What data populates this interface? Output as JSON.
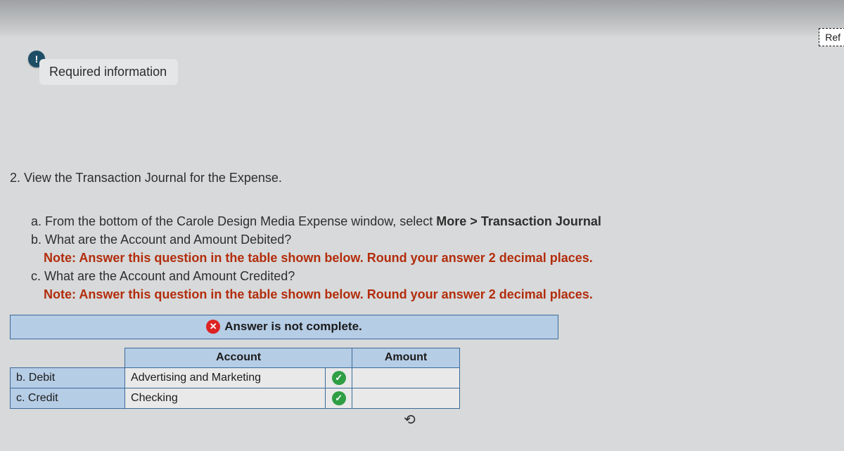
{
  "header": {
    "info_badge": "!",
    "required_label": "Required information",
    "ref_tab": "Ref"
  },
  "question": {
    "prompt": "2. View the Transaction Journal for the Expense.",
    "items": {
      "a": "a. From the bottom of the Carole Design Media Expense window, select ",
      "a_bold": "More > Transaction Journal",
      "b": "b. What are the Account and Amount Debited?",
      "b_note": "Note: Answer this question in the table shown below. Round your answer 2 decimal places.",
      "c": "c. What are the Account and Amount Credited?",
      "c_note": "Note: Answer this question in the table shown below. Round your answer 2 decimal places."
    }
  },
  "answer_table": {
    "status_label": "Answer is not complete.",
    "headers": {
      "account": "Account",
      "amount": "Amount"
    },
    "rows": [
      {
        "label": "b. Debit",
        "account": "Advertising and Marketing",
        "correct": true,
        "amount": ""
      },
      {
        "label": "c. Credit",
        "account": "Checking",
        "correct": true,
        "amount": ""
      }
    ]
  }
}
